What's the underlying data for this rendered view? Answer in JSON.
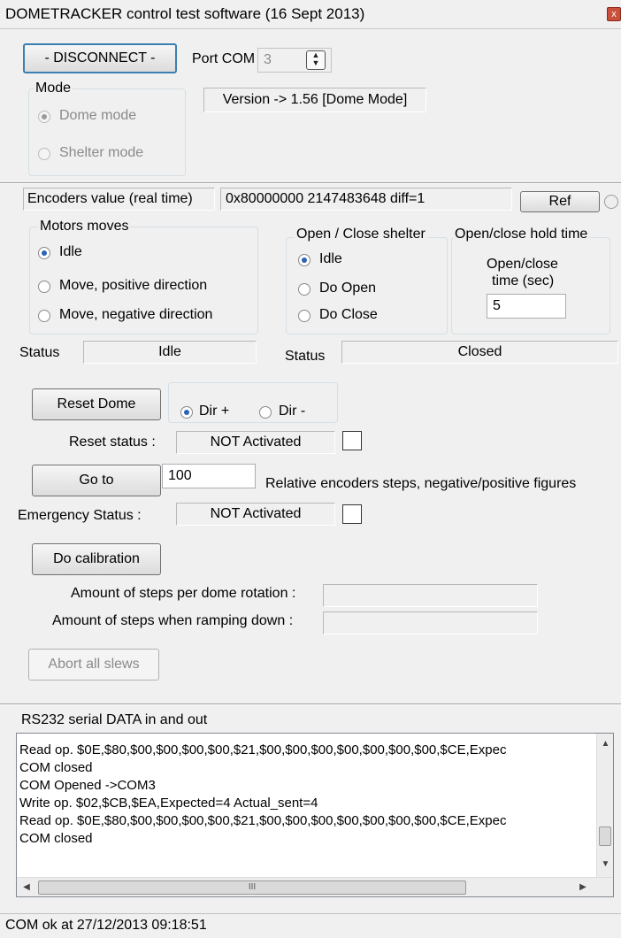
{
  "window": {
    "title": "DOMETRACKER control test software (16 Sept 2013)",
    "close_glyph": "x"
  },
  "connection": {
    "disconnect_label": "- DISCONNECT -",
    "port_label": "Port COM",
    "port_value": "3",
    "version_text": "Version -> 1.56 [Dome Mode]"
  },
  "mode": {
    "title": "Mode",
    "options": [
      {
        "label": "Dome mode",
        "selected": true
      },
      {
        "label": "Shelter mode",
        "selected": false
      }
    ]
  },
  "encoders": {
    "label": "Encoders value (real time)",
    "value": "0x80000000  2147483648  diff=1",
    "ref_label": "Ref"
  },
  "motors": {
    "title": "Motors moves",
    "options": [
      {
        "label": "Idle",
        "selected": true
      },
      {
        "label": "Move, positive direction",
        "selected": false
      },
      {
        "label": "Move, negative direction",
        "selected": false
      }
    ],
    "status_label": "Status",
    "status_value": "Idle"
  },
  "shelter": {
    "title": "Open / Close shelter",
    "options": [
      {
        "label": "Idle",
        "selected": true
      },
      {
        "label": "Do Open",
        "selected": false
      },
      {
        "label": "Do Close",
        "selected": false
      }
    ],
    "status_label": "Status",
    "status_value": "Closed"
  },
  "hold": {
    "title": "Open/close hold time",
    "caption_line1": "Open/close",
    "caption_line2": "time (sec)",
    "value": "5"
  },
  "reset": {
    "button_label": "Reset Dome",
    "dir_plus": "Dir +",
    "dir_minus": "Dir -",
    "status_label": "Reset status :",
    "status_value": "NOT Activated"
  },
  "goto": {
    "button_label": "Go to",
    "value": "100",
    "hint": "Relative encoders steps, negative/positive figures"
  },
  "emergency": {
    "label": "Emergency Status :",
    "value": "NOT Activated"
  },
  "calibration": {
    "button_label": "Do calibration",
    "steps_rotation_label": "Amount of steps per dome rotation :",
    "steps_ramp_label": "Amount of steps when ramping down :",
    "steps_rotation_value": "",
    "steps_ramp_value": ""
  },
  "abort": {
    "label": "Abort all slews"
  },
  "serial": {
    "title": "RS232 serial DATA in and out",
    "lines": [
      "Read op. $0E,$80,$00,$00,$00,$00,$21,$00,$00,$00,$00,$00,$00,$00,$CE,Expec",
      "COM closed",
      "COM Opened ->COM3",
      "Write op. $02,$CB,$EA,Expected=4 Actual_sent=4",
      "Read op. $0E,$80,$00,$00,$00,$00,$21,$00,$00,$00,$00,$00,$00,$00,$CE,Expec",
      "COM closed"
    ],
    "scroll_grip": "III"
  },
  "statusbar": {
    "text": "COM ok at 27/12/2013 09:18:51"
  }
}
